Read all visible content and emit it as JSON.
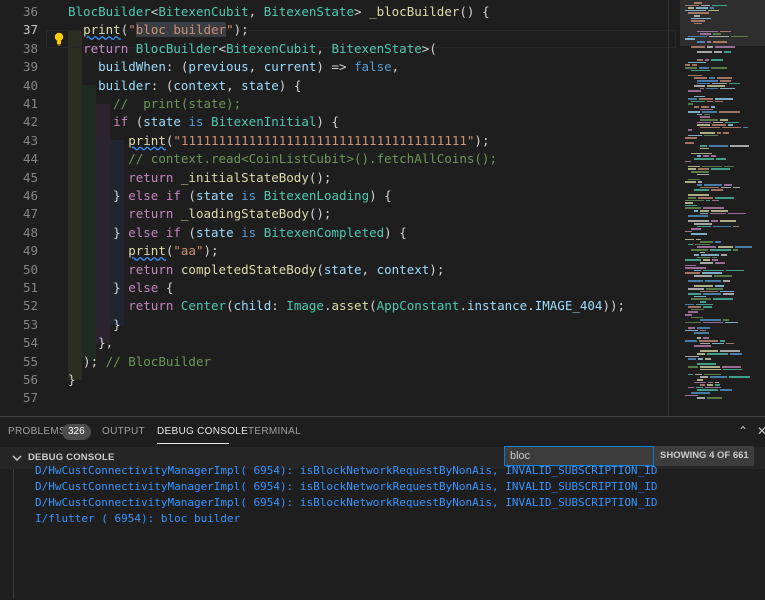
{
  "editor": {
    "line_numbers": [
      "36",
      "37",
      "38",
      "39",
      "40",
      "41",
      "42",
      "43",
      "44",
      "45",
      "46",
      "47",
      "48",
      "49",
      "50",
      "51",
      "52",
      "53",
      "54",
      "55",
      "56",
      "57"
    ],
    "active_line": "37",
    "lines": [
      [
        {
          "c": "t",
          "x": "BlocBuilder"
        },
        {
          "c": "p",
          "x": "<"
        },
        {
          "c": "t",
          "x": "BitexenCubit"
        },
        {
          "c": "p",
          "x": ", "
        },
        {
          "c": "t",
          "x": "BitexenState"
        },
        {
          "c": "p",
          "x": "> "
        },
        {
          "c": "f",
          "x": "_blocBuilder"
        },
        {
          "c": "p",
          "x": "() {"
        }
      ],
      [
        {
          "c": "p",
          "x": "  "
        },
        {
          "c": "f",
          "x": "print",
          "sq": 1
        },
        {
          "c": "p",
          "x": "("
        },
        {
          "c": "s",
          "x": "\""
        },
        {
          "c": "s",
          "x": "bloc builder",
          "hl": 1
        },
        {
          "c": "s",
          "x": "\""
        },
        {
          "c": "p",
          "x": ");"
        }
      ],
      [
        {
          "c": "p",
          "x": "  "
        },
        {
          "c": "c",
          "x": "return "
        },
        {
          "c": "t",
          "x": "BlocBuilder"
        },
        {
          "c": "p",
          "x": "<"
        },
        {
          "c": "t",
          "x": "BitexenCubit"
        },
        {
          "c": "p",
          "x": ", "
        },
        {
          "c": "t",
          "x": "BitexenState"
        },
        {
          "c": "p",
          "x": ">("
        }
      ],
      [
        {
          "c": "p",
          "x": "    "
        },
        {
          "c": "v",
          "x": "buildWhen"
        },
        {
          "c": "p",
          "x": ": ("
        },
        {
          "c": "v",
          "x": "previous"
        },
        {
          "c": "p",
          "x": ", "
        },
        {
          "c": "v",
          "x": "current"
        },
        {
          "c": "p",
          "x": ") => "
        },
        {
          "c": "k",
          "x": "false"
        },
        {
          "c": "p",
          "x": ","
        }
      ],
      [
        {
          "c": "p",
          "x": "    "
        },
        {
          "c": "v",
          "x": "builder"
        },
        {
          "c": "p",
          "x": ": ("
        },
        {
          "c": "v",
          "x": "context"
        },
        {
          "c": "p",
          "x": ", "
        },
        {
          "c": "v",
          "x": "state"
        },
        {
          "c": "p",
          "x": ") {"
        }
      ],
      [
        {
          "c": "p",
          "x": "      "
        },
        {
          "c": "cm",
          "x": "//  print(state);"
        }
      ],
      [
        {
          "c": "p",
          "x": "      "
        },
        {
          "c": "c",
          "x": "if"
        },
        {
          "c": "p",
          "x": " ("
        },
        {
          "c": "v",
          "x": "state"
        },
        {
          "c": "p",
          "x": " "
        },
        {
          "c": "k",
          "x": "is"
        },
        {
          "c": "p",
          "x": " "
        },
        {
          "c": "t",
          "x": "BitexenInitial"
        },
        {
          "c": "p",
          "x": ") {"
        }
      ],
      [
        {
          "c": "p",
          "x": "        "
        },
        {
          "c": "f",
          "x": "print",
          "sq": 1
        },
        {
          "c": "p",
          "x": "("
        },
        {
          "c": "s",
          "x": "\"11111111111111111111111111111111111111\""
        },
        {
          "c": "p",
          "x": ");"
        }
      ],
      [
        {
          "c": "p",
          "x": "        "
        },
        {
          "c": "cm",
          "x": "// context.read<CoinListCubit>().fetchAllCoins();"
        }
      ],
      [
        {
          "c": "p",
          "x": "        "
        },
        {
          "c": "c",
          "x": "return"
        },
        {
          "c": "p",
          "x": " "
        },
        {
          "c": "f",
          "x": "_initialStateBody"
        },
        {
          "c": "p",
          "x": "();"
        }
      ],
      [
        {
          "c": "p",
          "x": "      } "
        },
        {
          "c": "c",
          "x": "else if"
        },
        {
          "c": "p",
          "x": " ("
        },
        {
          "c": "v",
          "x": "state"
        },
        {
          "c": "p",
          "x": " "
        },
        {
          "c": "k",
          "x": "is"
        },
        {
          "c": "p",
          "x": " "
        },
        {
          "c": "t",
          "x": "BitexenLoading"
        },
        {
          "c": "p",
          "x": ") {"
        }
      ],
      [
        {
          "c": "p",
          "x": "        "
        },
        {
          "c": "c",
          "x": "return"
        },
        {
          "c": "p",
          "x": " "
        },
        {
          "c": "f",
          "x": "_loadingStateBody"
        },
        {
          "c": "p",
          "x": "();"
        }
      ],
      [
        {
          "c": "p",
          "x": "      } "
        },
        {
          "c": "c",
          "x": "else if"
        },
        {
          "c": "p",
          "x": " ("
        },
        {
          "c": "v",
          "x": "state"
        },
        {
          "c": "p",
          "x": " "
        },
        {
          "c": "k",
          "x": "is"
        },
        {
          "c": "p",
          "x": " "
        },
        {
          "c": "t",
          "x": "BitexenCompleted"
        },
        {
          "c": "p",
          "x": ") {"
        }
      ],
      [
        {
          "c": "p",
          "x": "        "
        },
        {
          "c": "f",
          "x": "print",
          "sq": 1
        },
        {
          "c": "p",
          "x": "("
        },
        {
          "c": "s",
          "x": "\"aa\""
        },
        {
          "c": "p",
          "x": ");"
        }
      ],
      [
        {
          "c": "p",
          "x": "        "
        },
        {
          "c": "c",
          "x": "return"
        },
        {
          "c": "p",
          "x": " "
        },
        {
          "c": "f",
          "x": "completedStateBody"
        },
        {
          "c": "p",
          "x": "("
        },
        {
          "c": "v",
          "x": "state"
        },
        {
          "c": "p",
          "x": ", "
        },
        {
          "c": "v",
          "x": "context"
        },
        {
          "c": "p",
          "x": ");"
        }
      ],
      [
        {
          "c": "p",
          "x": "      } "
        },
        {
          "c": "c",
          "x": "else"
        },
        {
          "c": "p",
          "x": " {"
        }
      ],
      [
        {
          "c": "p",
          "x": "        "
        },
        {
          "c": "c",
          "x": "return"
        },
        {
          "c": "p",
          "x": " "
        },
        {
          "c": "t",
          "x": "Center"
        },
        {
          "c": "p",
          "x": "("
        },
        {
          "c": "v",
          "x": "child"
        },
        {
          "c": "p",
          "x": ": "
        },
        {
          "c": "t",
          "x": "Image"
        },
        {
          "c": "p",
          "x": "."
        },
        {
          "c": "f",
          "x": "asset"
        },
        {
          "c": "p",
          "x": "("
        },
        {
          "c": "t",
          "x": "AppConstant"
        },
        {
          "c": "p",
          "x": "."
        },
        {
          "c": "v",
          "x": "instance"
        },
        {
          "c": "p",
          "x": "."
        },
        {
          "c": "v",
          "x": "IMAGE_404"
        },
        {
          "c": "p",
          "x": "));"
        }
      ],
      [
        {
          "c": "p",
          "x": "      }"
        }
      ],
      [
        {
          "c": "p",
          "x": "    },"
        }
      ],
      [
        {
          "c": "p",
          "x": "  ); "
        },
        {
          "c": "cm",
          "x": "// BlocBuilder"
        }
      ],
      [
        {
          "c": "p",
          "x": "}"
        }
      ],
      [
        {
          "c": "p",
          "x": ""
        }
      ]
    ]
  },
  "panel": {
    "tabs": [
      {
        "label": "PROBLEMS",
        "active": false
      },
      {
        "label": "OUTPUT",
        "active": false
      },
      {
        "label": "DEBUG CONSOLE",
        "active": true
      },
      {
        "label": "TERMINAL",
        "active": false
      }
    ],
    "problems_count": "326",
    "section_title": "DEBUG CONSOLE",
    "filter_value": "bloc",
    "filter_count": "SHOWING 4 OF 661",
    "output_lines": [
      "D/HwCustConnectivityManagerImpl( 6954): isBlockNetworkRequestByNonAis, INVALID_SUBSCRIPTION_ID",
      "D/HwCustConnectivityManagerImpl( 6954): isBlockNetworkRequestByNonAis, INVALID_SUBSCRIPTION_ID",
      "D/HwCustConnectivityManagerImpl( 6954): isBlockNetworkRequestByNonAis, INVALID_SUBSCRIPTION_ID",
      "I/flutter ( 6954): bloc builder"
    ]
  },
  "icons": {
    "lightbulb": "lightbulb-icon",
    "collapse": "chevron-down-icon",
    "maximize": "chevron-up-icon",
    "close": "close-icon"
  },
  "colors": {
    "background": "#1e1e1e",
    "keyword": "#569cd6",
    "control": "#c586c0",
    "type": "#4ec9b0",
    "function": "#dcdcaa",
    "string": "#ce9178",
    "variable": "#9cdcfe",
    "comment": "#6a9955",
    "console_text": "#3794ff",
    "accent": "#007fd4"
  }
}
